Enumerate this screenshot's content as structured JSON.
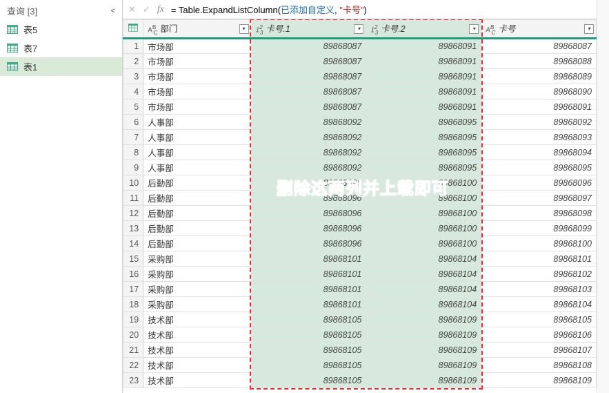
{
  "sidebar": {
    "title": "查询 [3]",
    "toggle_glyph": "<",
    "items": [
      {
        "label": "表5",
        "active": false
      },
      {
        "label": "表7",
        "active": false
      },
      {
        "label": "表1",
        "active": true
      }
    ]
  },
  "formula_bar": {
    "cancel_glyph": "✕",
    "accept_glyph": "✓",
    "fx_glyph": "fx",
    "formula_plain": "= Table.ExpandListColumn(已添加自定义, \"卡号\")",
    "parts": [
      {
        "t": "= Table.ExpandListColumn(",
        "c": ""
      },
      {
        "t": "已添加自定义",
        "c": "fl-blue"
      },
      {
        "t": ", ",
        "c": ""
      },
      {
        "t": "\"卡号\"",
        "c": "fl-red"
      },
      {
        "t": ")",
        "c": ""
      }
    ]
  },
  "columns": [
    {
      "name": "部门",
      "type": "ABC",
      "key": "dept"
    },
    {
      "name": "卡号.1",
      "type": "123",
      "key": "c1",
      "sel": true
    },
    {
      "name": "卡号.2",
      "type": "123",
      "key": "c2",
      "sel": true
    },
    {
      "name": "卡号",
      "type": "ABC",
      "key": "c3",
      "sel": false,
      "type_icon": "ABC/123"
    }
  ],
  "rows": [
    {
      "n": 1,
      "dept": "市场部",
      "c1": "89868087",
      "c2": "89868091",
      "c3": "89868087"
    },
    {
      "n": 2,
      "dept": "市场部",
      "c1": "89868087",
      "c2": "89868091",
      "c3": "89868088"
    },
    {
      "n": 3,
      "dept": "市场部",
      "c1": "89868087",
      "c2": "89868091",
      "c3": "89868089"
    },
    {
      "n": 4,
      "dept": "市场部",
      "c1": "89868087",
      "c2": "89868091",
      "c3": "89868090"
    },
    {
      "n": 5,
      "dept": "市场部",
      "c1": "89868087",
      "c2": "89868091",
      "c3": "89868091"
    },
    {
      "n": 6,
      "dept": "人事部",
      "c1": "89868092",
      "c2": "89868095",
      "c3": "89868092"
    },
    {
      "n": 7,
      "dept": "人事部",
      "c1": "89868092",
      "c2": "89868095",
      "c3": "89868093"
    },
    {
      "n": 8,
      "dept": "人事部",
      "c1": "89868092",
      "c2": "89868095",
      "c3": "89868094"
    },
    {
      "n": 9,
      "dept": "人事部",
      "c1": "89868092",
      "c2": "89868095",
      "c3": "89868095"
    },
    {
      "n": 10,
      "dept": "后勤部",
      "c1": "89868096",
      "c2": "89868100",
      "c3": "89868096"
    },
    {
      "n": 11,
      "dept": "后勤部",
      "c1": "89868096",
      "c2": "89868100",
      "c3": "89868097"
    },
    {
      "n": 12,
      "dept": "后勤部",
      "c1": "89868096",
      "c2": "89868100",
      "c3": "89868098"
    },
    {
      "n": 13,
      "dept": "后勤部",
      "c1": "89868096",
      "c2": "89868100",
      "c3": "89868099"
    },
    {
      "n": 14,
      "dept": "后勤部",
      "c1": "89868096",
      "c2": "89868100",
      "c3": "89868100"
    },
    {
      "n": 15,
      "dept": "采购部",
      "c1": "89868101",
      "c2": "89868104",
      "c3": "89868101"
    },
    {
      "n": 16,
      "dept": "采购部",
      "c1": "89868101",
      "c2": "89868104",
      "c3": "89868102"
    },
    {
      "n": 17,
      "dept": "采购部",
      "c1": "89868101",
      "c2": "89868104",
      "c3": "89868103"
    },
    {
      "n": 18,
      "dept": "采购部",
      "c1": "89868101",
      "c2": "89868104",
      "c3": "89868104"
    },
    {
      "n": 19,
      "dept": "技术部",
      "c1": "89868105",
      "c2": "89868109",
      "c3": "89868105"
    },
    {
      "n": 20,
      "dept": "技术部",
      "c1": "89868105",
      "c2": "89868109",
      "c3": "89868106"
    },
    {
      "n": 21,
      "dept": "技术部",
      "c1": "89868105",
      "c2": "89868109",
      "c3": "89868107"
    },
    {
      "n": 22,
      "dept": "技术部",
      "c1": "89868105",
      "c2": "89868109",
      "c3": "89868108"
    },
    {
      "n": 23,
      "dept": "技术部",
      "c1": "89868105",
      "c2": "89868109",
      "c3": "89868109"
    }
  ],
  "annotation": "删除这两列并上载即可"
}
